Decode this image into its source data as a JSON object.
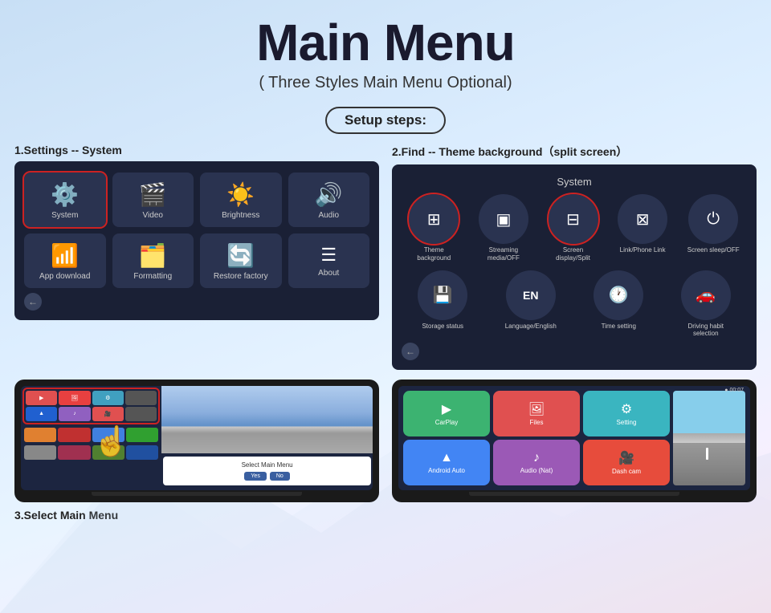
{
  "header": {
    "title": "Main Menu",
    "subtitle": "( Three Styles Main Menu Optional)",
    "badge": "Setup steps:"
  },
  "step1": {
    "label": "1.Settings -- System",
    "icons": [
      {
        "id": "system",
        "label": "System",
        "icon": "⚙️",
        "highlighted": true
      },
      {
        "id": "video",
        "label": "Video",
        "icon": "📹",
        "highlighted": false
      },
      {
        "id": "brightness",
        "label": "Brightness",
        "icon": "☀️",
        "highlighted": false
      },
      {
        "id": "audio",
        "label": "Audio",
        "icon": "🔊",
        "highlighted": false
      },
      {
        "id": "app-download",
        "label": "App download",
        "icon": "📶",
        "highlighted": false
      },
      {
        "id": "formatting",
        "label": "Formatting",
        "icon": "🗂️",
        "highlighted": false
      },
      {
        "id": "restore",
        "label": "Restore factory",
        "icon": "🔄",
        "highlighted": false
      },
      {
        "id": "about",
        "label": "About",
        "icon": "≡",
        "highlighted": false
      }
    ]
  },
  "step2": {
    "label": "2.Find -- Theme background（split screen）",
    "system_title": "System",
    "icons": [
      {
        "id": "theme",
        "label": "Theme\nbackground",
        "highlighted": true
      },
      {
        "id": "streaming",
        "label": "Streaming\nmedia/OFF",
        "highlighted": false
      },
      {
        "id": "screen-split",
        "label": "Screen\ndisplay/Split",
        "highlighted": true
      },
      {
        "id": "link",
        "label": "Link/Phone Link",
        "highlighted": false
      },
      {
        "id": "sleep",
        "label": "Screen sleep/OFF",
        "highlighted": false
      },
      {
        "id": "storage",
        "label": "Storage status",
        "highlighted": false
      },
      {
        "id": "language",
        "label": "Language/English",
        "highlighted": false
      },
      {
        "id": "time",
        "label": "Time setting",
        "highlighted": false
      },
      {
        "id": "driving",
        "label": "Driving habit\nselection",
        "highlighted": false
      }
    ]
  },
  "step3": {
    "label": "3.Select Main Menu"
  },
  "app_tiles": [
    {
      "label": "CarPlay",
      "color": "#3cb371",
      "icon": "▶"
    },
    {
      "label": "Files",
      "color": "#e05050",
      "icon": "🖼"
    },
    {
      "label": "Setting",
      "color": "#3ab5c0",
      "icon": "⚙"
    },
    {
      "label": "Android Auto",
      "color": "#4285f4",
      "icon": "▲"
    },
    {
      "label": "Audio (Nat)",
      "color": "#9b59b6",
      "icon": "♪"
    },
    {
      "label": "Dash cam",
      "color": "#e74c3c",
      "icon": "🎥"
    }
  ],
  "dialog": {
    "yes": "Yes",
    "no": "No"
  }
}
